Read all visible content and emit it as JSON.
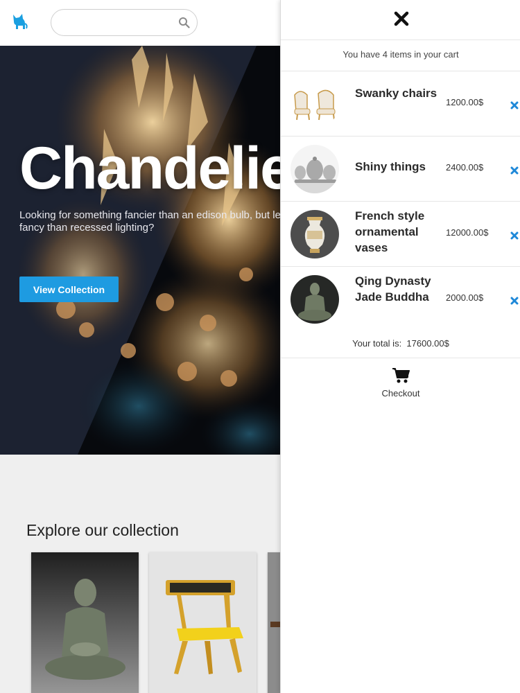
{
  "header": {
    "logo_icon": "cat-logo-icon",
    "search": {
      "value": "",
      "placeholder": "",
      "icon": "search-icon"
    }
  },
  "hero": {
    "title": "Chandelier",
    "subtitle": "Looking for something fancier than an edison bulb, but less fancy than recessed lighting?",
    "cta_label": "View Collection",
    "accent_color": "#1e9be1"
  },
  "collection": {
    "heading": "Explore our collection",
    "cards": [
      {
        "image": "jade-buddha-statue"
      },
      {
        "image": "yellow-painted-chair"
      },
      {
        "image": "partially-visible-item"
      }
    ]
  },
  "cart": {
    "close_icon": "close-icon",
    "count_text": "You have 4 items in your cart",
    "items": [
      {
        "name": "Swanky chairs",
        "price": "1200.00$",
        "thumb": "chairs"
      },
      {
        "name": "Shiny things",
        "price": "2400.00$",
        "thumb": "silver-tea-set"
      },
      {
        "name": "French style ornamental vases",
        "price": "12000.00$",
        "thumb": "vase"
      },
      {
        "name": "Qing Dynasty Jade Buddha",
        "price": "2000.00$",
        "thumb": "buddha"
      }
    ],
    "remove_icon": "remove-x-icon",
    "remove_color": "#1e88d8",
    "total_label": "Your total is:",
    "total_value": "17600.00$",
    "checkout_label": "Checkout",
    "checkout_icon": "shopping-cart-icon"
  }
}
